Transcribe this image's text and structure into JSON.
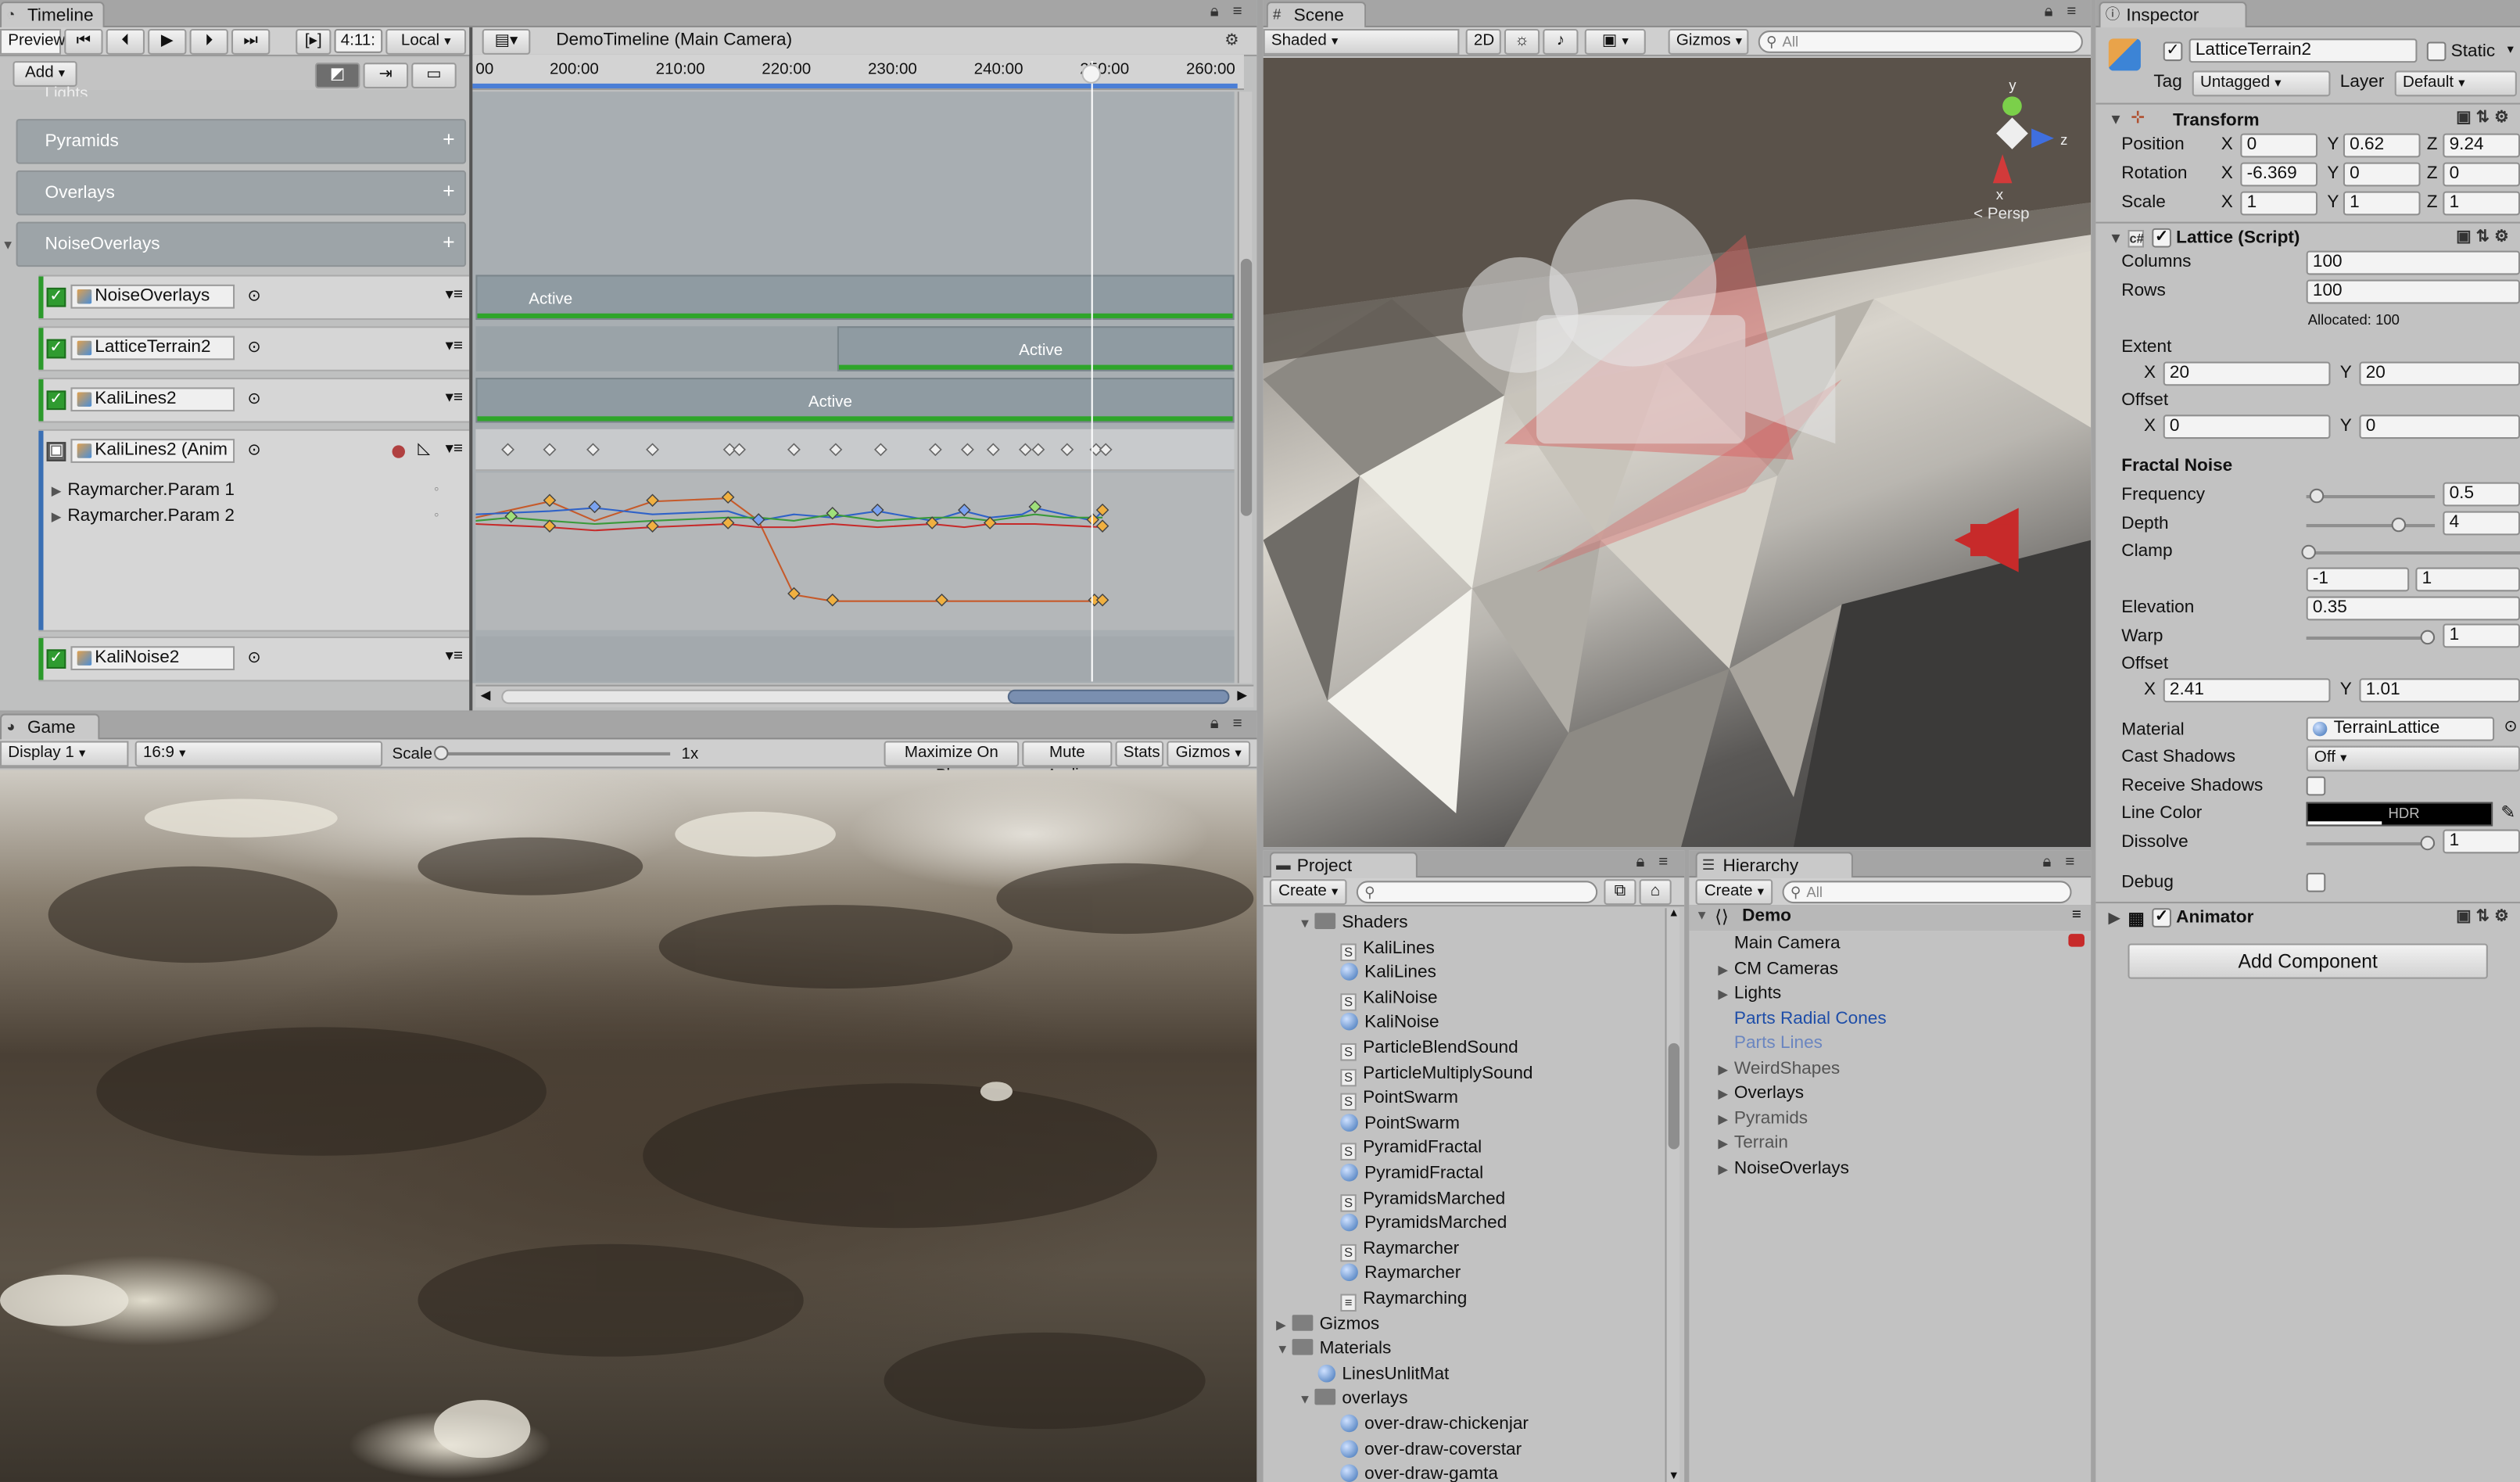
{
  "timeline": {
    "tab": "Timeline",
    "preview": "Preview",
    "time": "4:11:",
    "local": "Local",
    "add": "Add",
    "title": "DemoTimeline (Main Camera)",
    "ruler_ticks": [
      "00",
      "200:00",
      "210:00",
      "220:00",
      "230:00",
      "240:00",
      "250:00",
      "260:00"
    ],
    "top_label": "Lights",
    "groups": [
      "Pyramids",
      "Overlays",
      "NoiseOverlays"
    ],
    "tracks": [
      {
        "name": "NoiseOverlays",
        "clip": "Active"
      },
      {
        "name": "LatticeTerrain2",
        "clip": "Active"
      },
      {
        "name": "KaliLines2",
        "clip": "Active"
      },
      {
        "name": "KaliLines2 (Anim"
      },
      {
        "name": "KaliNoise2"
      }
    ],
    "params": [
      "Raymarcher.Param 1",
      "Raymarcher.Param 2"
    ]
  },
  "scene": {
    "tab": "Scene",
    "shading": "Shaded",
    "mode2d": "2D",
    "gizmos": "Gizmos",
    "search": "All",
    "persp": "< Persp",
    "axis_y": "y",
    "axis_x": "x",
    "axis_z": "z"
  },
  "game": {
    "tab": "Game",
    "display": "Display 1",
    "aspect": "16:9",
    "scale_label": "Scale",
    "scale_value": "1x",
    "buttons": [
      "Maximize On Play",
      "Mute Audio",
      "Stats",
      "Gizmos"
    ]
  },
  "project": {
    "tab": "Project",
    "create": "Create",
    "items": [
      {
        "label": "Shaders",
        "kind": "folder",
        "indent": 1,
        "open": true
      },
      {
        "label": "KaliLines",
        "kind": "script",
        "indent": 2
      },
      {
        "label": "KaliLines",
        "kind": "shader",
        "indent": 2
      },
      {
        "label": "KaliNoise",
        "kind": "script",
        "indent": 2
      },
      {
        "label": "KaliNoise",
        "kind": "shader",
        "indent": 2
      },
      {
        "label": "ParticleBlendSound",
        "kind": "script",
        "indent": 2
      },
      {
        "label": "ParticleMultiplySound",
        "kind": "script",
        "indent": 2
      },
      {
        "label": "PointSwarm",
        "kind": "script",
        "indent": 2
      },
      {
        "label": "PointSwarm",
        "kind": "shader",
        "indent": 2
      },
      {
        "label": "PyramidFractal",
        "kind": "script",
        "indent": 2
      },
      {
        "label": "PyramidFractal",
        "kind": "shader",
        "indent": 2
      },
      {
        "label": "PyramidsMarched",
        "kind": "script",
        "indent": 2
      },
      {
        "label": "PyramidsMarched",
        "kind": "shader",
        "indent": 2
      },
      {
        "label": "Raymarcher",
        "kind": "script",
        "indent": 2
      },
      {
        "label": "Raymarcher",
        "kind": "shader",
        "indent": 2
      },
      {
        "label": "Raymarching",
        "kind": "file",
        "indent": 2
      },
      {
        "label": "Gizmos",
        "kind": "folder",
        "indent": 0,
        "open": false
      },
      {
        "label": "Materials",
        "kind": "folder",
        "indent": 0,
        "open": true
      },
      {
        "label": "LinesUnlitMat",
        "kind": "shader",
        "indent": 1
      },
      {
        "label": "overlays",
        "kind": "folder",
        "indent": 1,
        "open": true
      },
      {
        "label": "over-draw-chickenjar",
        "kind": "shader",
        "indent": 2
      },
      {
        "label": "over-draw-coverstar",
        "kind": "shader",
        "indent": 2
      },
      {
        "label": "over-draw-gamta",
        "kind": "shader",
        "indent": 2
      }
    ]
  },
  "hierarchy": {
    "tab": "Hierarchy",
    "create": "Create",
    "search": "All",
    "scene": "Demo",
    "items": [
      {
        "label": "Main Camera",
        "arrow": false,
        "style": "normal"
      },
      {
        "label": "CM Cameras",
        "arrow": true,
        "style": "normal"
      },
      {
        "label": "Lights",
        "arrow": true,
        "style": "normal"
      },
      {
        "label": "Parts Radial Cones",
        "arrow": false,
        "style": "prefab"
      },
      {
        "label": "Parts Lines",
        "arrow": false,
        "style": "prefab-dim"
      },
      {
        "label": "WeirdShapes",
        "arrow": true,
        "style": "dim"
      },
      {
        "label": "Overlays",
        "arrow": true,
        "style": "normal"
      },
      {
        "label": "Pyramids",
        "arrow": true,
        "style": "dim"
      },
      {
        "label": "Terrain",
        "arrow": true,
        "style": "dim"
      },
      {
        "label": "NoiseOverlays",
        "arrow": true,
        "style": "normal"
      }
    ]
  },
  "inspector": {
    "tab": "Inspector",
    "object_name": "LatticeTerrain2",
    "static": "Static",
    "tag_label": "Tag",
    "tag": "Untagged",
    "layer_label": "Layer",
    "layer": "Default",
    "transform": {
      "title": "Transform",
      "position": {
        "label": "Position",
        "x": "0",
        "y": "0.62",
        "z": "9.24"
      },
      "rotation": {
        "label": "Rotation",
        "x": "-6.369",
        "y": "0",
        "z": "0"
      },
      "scale": {
        "label": "Scale",
        "x": "1",
        "y": "1",
        "z": "1"
      }
    },
    "lattice": {
      "title": "Lattice (Script)",
      "columns_label": "Columns",
      "columns": "100",
      "rows_label": "Rows",
      "rows": "100",
      "allocated": "Allocated: 100",
      "extent_label": "Extent",
      "extent_x": "20",
      "extent_y": "20",
      "offset_label": "Offset",
      "offset_x": "0",
      "offset_y": "0",
      "fractal_title": "Fractal Noise",
      "frequency_label": "Frequency",
      "frequency": "0.5",
      "depth_label": "Depth",
      "depth": "4",
      "clamp_label": "Clamp",
      "clamp_min": "-1",
      "clamp_max": "1",
      "elevation_label": "Elevation",
      "elevation": "0.35",
      "warp_label": "Warp",
      "warp": "1",
      "offset2_label": "Offset",
      "offset2_x": "2.41",
      "offset2_y": "1.01",
      "material_label": "Material",
      "material": "TerrainLattice",
      "cast_label": "Cast Shadows",
      "cast": "Off",
      "receive_label": "Receive Shadows",
      "linecolor_label": "Line Color",
      "hdr": "HDR",
      "dissolve_label": "Dissolve",
      "dissolve": "1",
      "debug_label": "Debug"
    },
    "animator": "Animator",
    "add_component": "Add Component"
  },
  "colors": {
    "track_green": "#2ea52a",
    "clip": "#8f9ba2",
    "group": "#9da4a8",
    "prefab": "#1f4ea8"
  }
}
